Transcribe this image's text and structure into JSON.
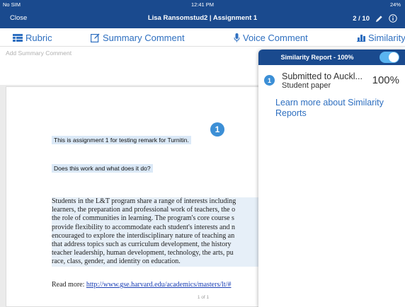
{
  "status_bar": {
    "carrier": "No SIM",
    "time": "12:41 PM",
    "battery": "24%"
  },
  "nav": {
    "close_label": "Close",
    "title": "Lisa Ransomstud2  |  Assignment 1",
    "pager": "2 / 10"
  },
  "toolbar": {
    "rubric_label": "Rubric",
    "summary_label": "Summary Comment",
    "voice_label": "Voice Comment",
    "similarity_label": "Similarity"
  },
  "summary_comment": {
    "placeholder": "Add Summary Comment"
  },
  "document": {
    "marker_number": "1",
    "line1": "This is assignment 1 for testing remark for Turnitin.",
    "line2": "Does this work and what does it do?",
    "paragraph_lines": [
      "Students in the L&T program share a range of interests including",
      "learners, the preparation and professional work of teachers, the o",
      "the role of communities in learning. The program's core course s",
      "provide flexibility to accommodate each student's interests and n",
      "encouraged to explore the interdisciplinary nature of teaching an",
      "that address topics such as curriculum development, the history",
      "teacher leadership, human development, technology, the arts, pu",
      "race, class, gender, and identity on education."
    ],
    "read_more_prefix": "Read more: ",
    "read_more_link": "http://www.gse.harvard.edu/academics/masters/lt/#",
    "page_number": "1 of 1"
  },
  "similarity_popover": {
    "title": "Similarity Report - 100%",
    "toggle_on": true,
    "matches": [
      {
        "number": "1",
        "source": "Submitted to Auckl...",
        "type": "Student paper",
        "percent": "100%"
      }
    ],
    "learn_more": "Learn more about Similarity Reports"
  },
  "colors": {
    "nav_bg": "#1a4a8e",
    "accent": "#2e6fc0",
    "marker": "#3c8fd6",
    "toggle": "#5ab4f0",
    "highlight": "#dbe9f7"
  }
}
